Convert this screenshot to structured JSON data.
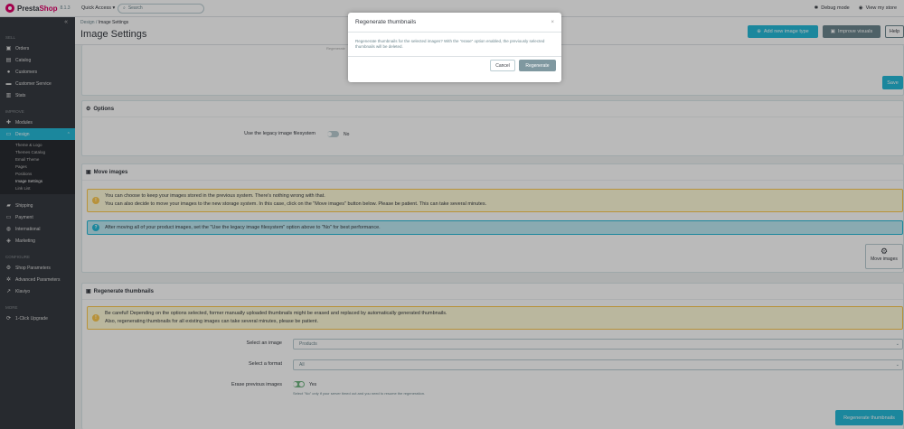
{
  "topbar": {
    "brand_a": "Presta",
    "brand_b": "Shop",
    "version": "8.1.3",
    "quick_access": "Quick Access ▾",
    "search_placeholder": "Search",
    "debug_mode": "Debug mode",
    "view_store": "View my store"
  },
  "sidebar": {
    "sections": {
      "sell": "SELL",
      "improve": "IMPROVE",
      "configure": "CONFIGURE",
      "more": "MORE"
    },
    "sell_items": [
      "Orders",
      "Catalog",
      "Customers",
      "Customer Service",
      "Stats"
    ],
    "improve_items": [
      "Modules",
      "Design"
    ],
    "design_sub": [
      "Theme & Logo",
      "Themes Catalog",
      "Email Theme",
      "Pages",
      "Positions",
      "Image Settings",
      "Link List"
    ],
    "improve_items_2": [
      "Shipping",
      "Payment",
      "International",
      "Marketing"
    ],
    "configure_items": [
      "Shop Parameters",
      "Advanced Parameters",
      "Klaviyo"
    ],
    "more_items": [
      "1-Click Upgrade"
    ]
  },
  "header": {
    "breadcrumb_1": "Design",
    "breadcrumb_sep": "/",
    "breadcrumb_2": "Image Settings",
    "title": "Image Settings",
    "add_btn": "Add new image type",
    "improve_btn": "Improve visuals",
    "help_btn": "Help"
  },
  "top_panel": {
    "faded_text": "Regenerate",
    "save_label": "Save"
  },
  "options_panel": {
    "title": "Options",
    "legacy_label": "Use the legacy image filesystem",
    "legacy_value": "No"
  },
  "move_panel": {
    "title": "Move images",
    "warn_line1": "You can choose to keep your images stored in the previous system. There's nothing wrong with that.",
    "warn_line2": "You can also decide to move your images to the new storage system. In this case, click on the \"Move images\" button below. Please be patient. This can take several minutes.",
    "info_text": "After moving all of your product images, set the \"Use the legacy image filesystem\" option above to \"No\" for best performance.",
    "move_btn": "Move images"
  },
  "regen_panel": {
    "title": "Regenerate thumbnails",
    "warn_line1": "Be careful! Depending on the options selected, former manually uploaded thumbnails might be erased and replaced by automatically generated thumbnails.",
    "warn_line2": "Also, regenerating thumbnails for all existing images can take several minutes, please be patient.",
    "select_image_label": "Select an image",
    "select_image_value": "Products",
    "select_format_label": "Select a format",
    "select_format_value": "All",
    "erase_label": "Erase previous images",
    "erase_value": "Yes",
    "erase_help": "Select \"No\" only if your server timed out and you need to resume the regeneration.",
    "regen_btn": "Regenerate thumbnails"
  },
  "modal": {
    "title": "Regenerate thumbnails",
    "close": "×",
    "body": "Regenerate thumbnails for the selected images? With the \"erase\" option enabled, the previously selected thumbnails will be deleted.",
    "cancel": "Cancel",
    "confirm": "Regenerate"
  },
  "colors": {
    "primary": "#25b9d7",
    "sidebar": "#363a41",
    "brand": "#df0067",
    "confirm": "#7f98a0"
  }
}
